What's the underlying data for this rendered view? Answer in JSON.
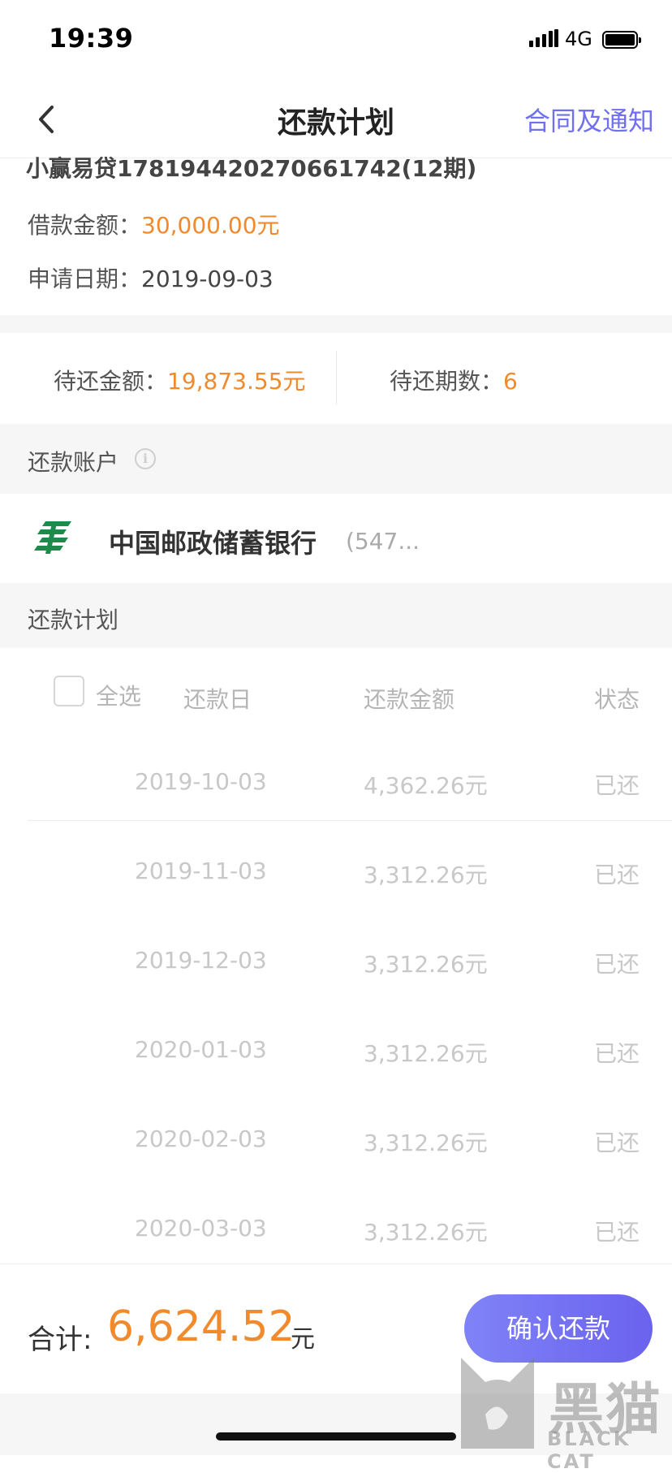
{
  "status_bar": {
    "time": "19:39",
    "network": "4G"
  },
  "nav": {
    "title": "还款计划",
    "right_link": "合同及通知"
  },
  "loan": {
    "name": "小赢易贷178194420270661742(12期)",
    "amount_label": "借款金额：",
    "amount_value": "30,000.00元",
    "date_label": "申请日期：",
    "date_value": "2019-09-03"
  },
  "pending": {
    "amount_label": "待还金额：",
    "amount_value": "19,873.55元",
    "count_label": "待还期数：",
    "count_value": "6"
  },
  "account_section": {
    "title": "还款账户"
  },
  "bank": {
    "name": "中国邮政储蓄银行",
    "suffix": "(547..."
  },
  "plan_section": {
    "title": "还款计划"
  },
  "table": {
    "select_all": "全选",
    "headers": {
      "date": "还款日",
      "amount": "还款金额",
      "status": "状态"
    },
    "rows": [
      {
        "date": "2019-10-03",
        "amount": "4,362.26元",
        "status": "已还"
      },
      {
        "date": "2019-11-03",
        "amount": "3,312.26元",
        "status": "已还"
      },
      {
        "date": "2019-12-03",
        "amount": "3,312.26元",
        "status": "已还"
      },
      {
        "date": "2020-01-03",
        "amount": "3,312.26元",
        "status": "已还"
      },
      {
        "date": "2020-02-03",
        "amount": "3,312.26元",
        "status": "已还"
      },
      {
        "date": "2020-03-03",
        "amount": "3,312.26元",
        "status": "已还"
      }
    ]
  },
  "footer": {
    "total_label": "合计:",
    "total_value": "6,624.52",
    "total_unit": "元",
    "confirm_label": "确认还款"
  },
  "watermark": {
    "text": "黑猫",
    "sub": "BLACK CAT"
  },
  "colors": {
    "accent_orange": "#f08a2c",
    "link_purple": "#6f6ff0",
    "button_gradient": [
      "#7f83f7",
      "#6b62ee"
    ],
    "postal_green": "#1e8a4c"
  },
  "icons": {
    "back": "chevron-left-icon",
    "info": "info-circle-icon",
    "bank_logo": "postal-bank-logo",
    "battery": "battery-icon",
    "signal": "signal-bars-icon"
  }
}
